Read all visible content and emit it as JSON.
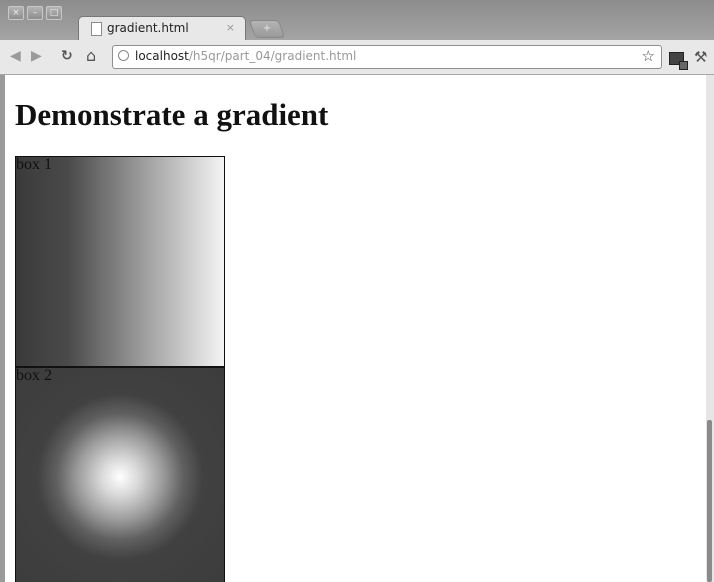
{
  "window": {
    "controls": [
      "×",
      "–",
      "□"
    ]
  },
  "tab": {
    "title": "gradient.html",
    "close": "×",
    "new_tab": "+"
  },
  "toolbar": {
    "back": "◀",
    "forward": "▶",
    "reload": "↻",
    "home": "⌂",
    "url_host": "localhost",
    "url_path": "/h5qr/part_04/gradient.html",
    "bookmark_star": "☆",
    "wrench": "🔧"
  },
  "page": {
    "heading": "Demonstrate a gradient",
    "box1_label": "box 1",
    "box2_label": "box 2"
  },
  "icons": {
    "back": "back-arrow-icon",
    "forward": "forward-arrow-icon",
    "reload": "reload-icon",
    "home": "home-icon",
    "site": "globe-icon",
    "bookmark": "star-icon",
    "page_menu": "page-menu-icon",
    "tools": "wrench-icon"
  }
}
